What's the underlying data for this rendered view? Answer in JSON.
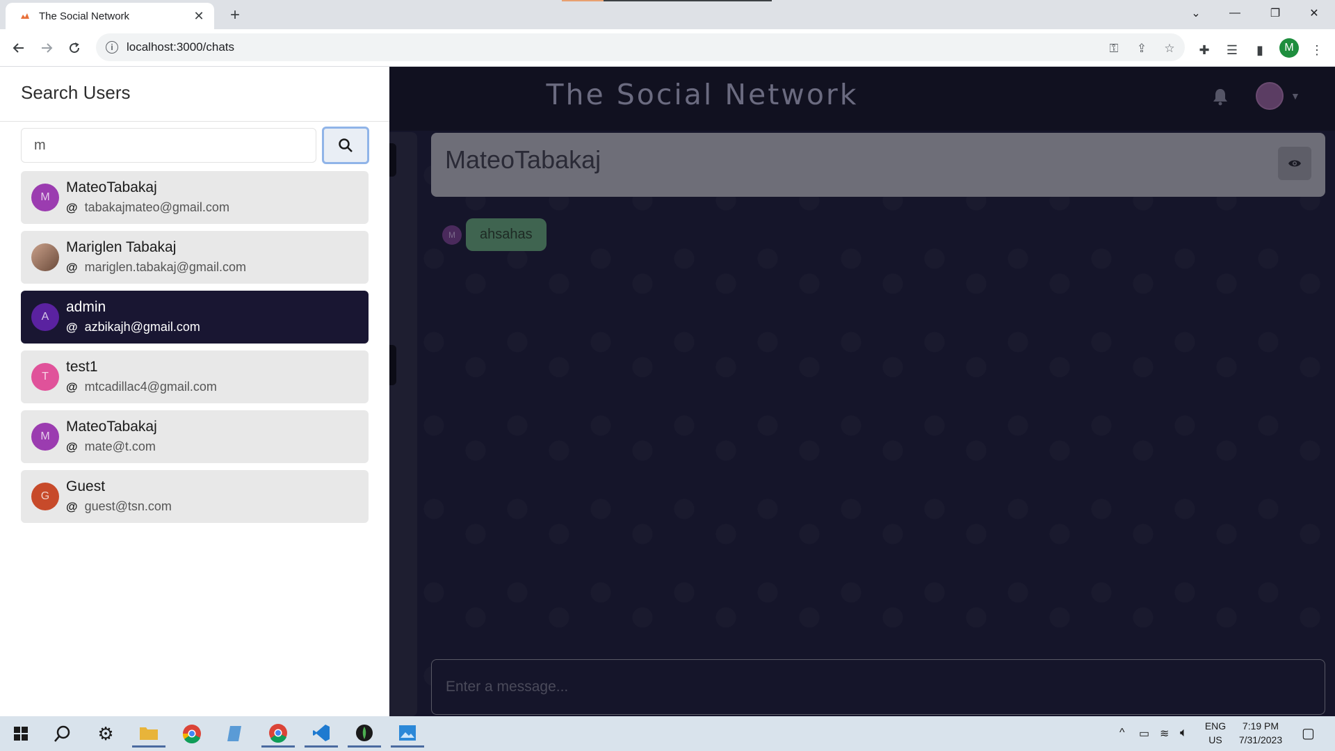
{
  "browser": {
    "tab_title": "The Social Network",
    "tab_close": "✕",
    "new_tab": "+",
    "url": "localhost:3000/chats",
    "profile_initial": "M",
    "window_controls": {
      "dropdown": "⌄",
      "minimize": "—",
      "restore": "❐",
      "close": "✕"
    }
  },
  "app": {
    "title": "The Social Network",
    "chat": {
      "name": "MateoTabakaj",
      "messages": [
        {
          "avatar_initial": "M",
          "text": "ahsahas"
        }
      ],
      "input_placeholder": "Enter a message..."
    }
  },
  "drawer": {
    "title": "Search Users",
    "search_value": "m",
    "users": [
      {
        "name": "MateoTabakaj",
        "email": "tabakajmateo@gmail.com",
        "initial": "M",
        "color": "#9b3cb0",
        "selected": false
      },
      {
        "name": "Mariglen Tabakaj",
        "email": "mariglen.tabakaj@gmail.com",
        "initial": "",
        "color": "#8a6a5a",
        "selected": false
      },
      {
        "name": "admin",
        "email": "azbikajh@gmail.com",
        "initial": "A",
        "color": "#5a22a0",
        "selected": true
      },
      {
        "name": "test1",
        "email": "mtcadillac4@gmail.com",
        "initial": "T",
        "color": "#e0529a",
        "selected": false
      },
      {
        "name": "MateoTabakaj",
        "email": "mate@t.com",
        "initial": "M",
        "color": "#9b3cb0",
        "selected": false
      },
      {
        "name": "Guest",
        "email": "guest@tsn.com",
        "initial": "G",
        "color": "#c74a2a",
        "selected": false
      }
    ]
  },
  "taskbar": {
    "language": "ENG",
    "region": "US",
    "time": "7:19 PM",
    "date": "7/31/2023"
  }
}
